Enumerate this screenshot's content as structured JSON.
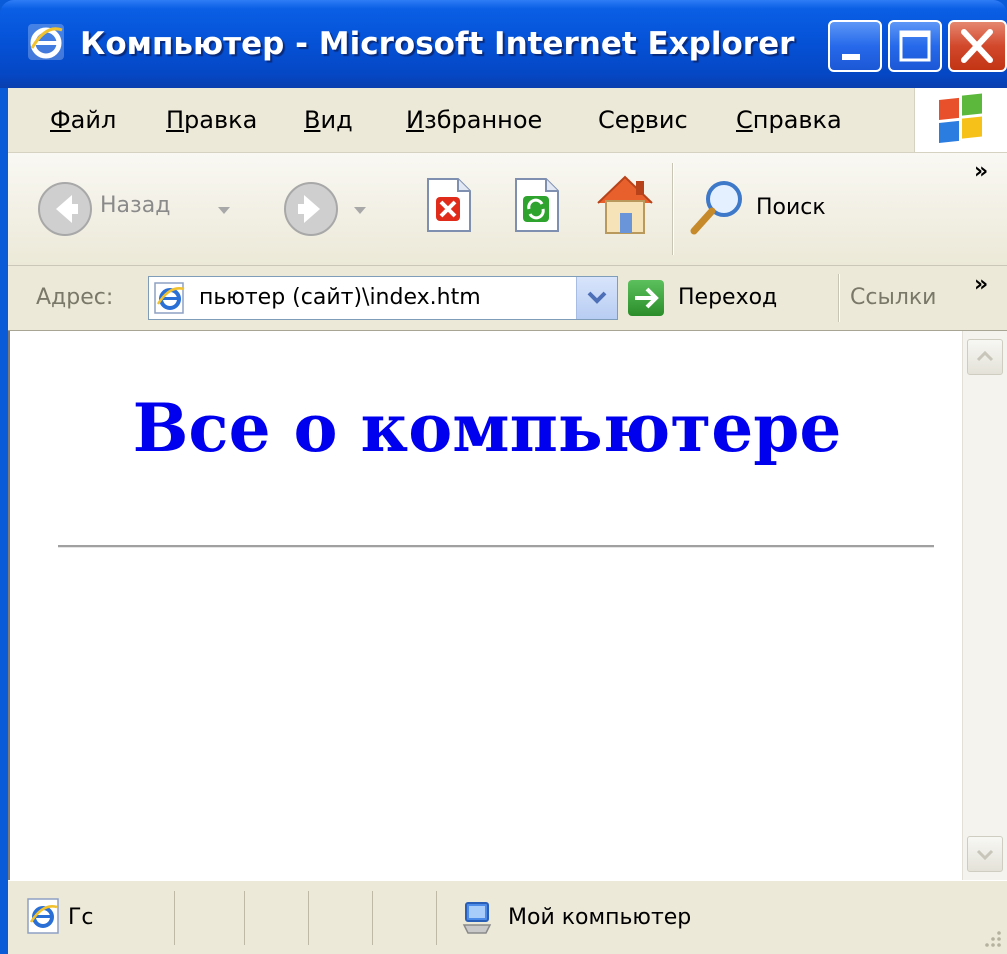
{
  "window": {
    "title": "Компьютер - Microsoft Internet Explorer"
  },
  "menu": {
    "items": [
      {
        "first": "Ф",
        "rest": "айл"
      },
      {
        "first": "П",
        "rest": "равка"
      },
      {
        "first": "В",
        "rest": "ид"
      },
      {
        "first": "И",
        "rest": "збранное"
      },
      {
        "first": "Се",
        "u": "р",
        "rest": "вис"
      },
      {
        "first": "С",
        "rest": "правка"
      }
    ]
  },
  "toolbar": {
    "back_label": "Назад",
    "search_label": "Поиск",
    "more": "»"
  },
  "address": {
    "label": "Адрес:",
    "value": "пьютер (сайт)\\index.htm",
    "go_label": "Переход",
    "links_label": "Ссылки",
    "more": "»"
  },
  "page": {
    "heading": "Все о компьютере"
  },
  "status": {
    "text": "Гс",
    "zone": "Мой компьютер"
  },
  "colors": {
    "title_bar": "#0551d6",
    "heading": "#0000ee",
    "chrome": "#ece9d8"
  }
}
